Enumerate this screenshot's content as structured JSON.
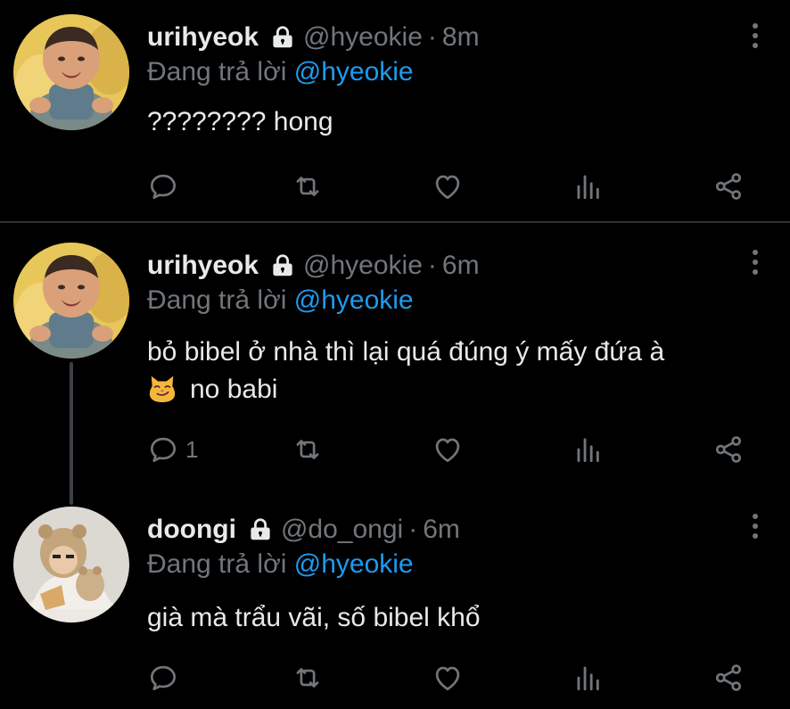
{
  "tweets": [
    {
      "name": "urihyeok",
      "handle": "@hyeokie",
      "dot": "·",
      "time": "8m",
      "replying_prefix": "Đang trả lời ",
      "replying_to": "@hyeokie",
      "text": "???????? hong",
      "reply_count": "",
      "avatar": "baby-photo"
    },
    {
      "name": "urihyeok",
      "handle": "@hyeokie",
      "dot": "·",
      "time": "6m",
      "replying_prefix": "Đang trả lời ",
      "replying_to": "@hyeokie",
      "text_line1": "bỏ bibel ở nhà thì lại quá đúng ý mấy đứa à",
      "text_line2": "no babi",
      "emoji": "smirking-cat-emoji",
      "reply_count": "1",
      "avatar": "baby-photo"
    },
    {
      "name": "doongi",
      "handle": "@do_ongi",
      "dot": "·",
      "time": "6m",
      "replying_prefix": "Đang trả lời ",
      "replying_to": "@hyeokie",
      "text": "già mà trẩu vãi, số bibel khổ",
      "reply_count": "",
      "avatar": "bear-hat-photo"
    }
  ],
  "icons": {
    "reply": "comment-icon",
    "retweet": "retweet-icon",
    "like": "heart-icon",
    "analytics": "analytics-icon",
    "share": "share-icon",
    "lock": "lock-icon",
    "more": "more-vertical-icon"
  },
  "colors": {
    "background": "#000000",
    "text": "#e7e9ea",
    "muted": "#71767b",
    "link": "#1d9bf0",
    "divider": "#2f3336"
  }
}
